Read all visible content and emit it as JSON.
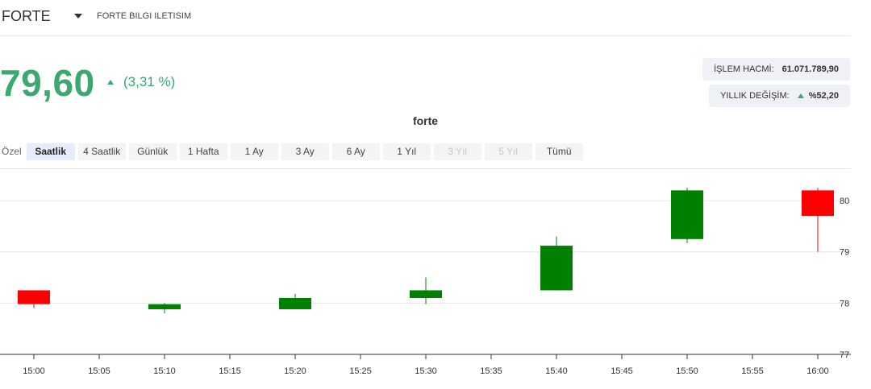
{
  "header": {
    "symbol": "FORTE",
    "company": "FORTE BILGI ILETISIM"
  },
  "quote": {
    "price": "79,60",
    "change": "(3,31 %)",
    "direction": "up",
    "up_color": "#3aa86f"
  },
  "stats": {
    "volume_label": "İŞLEM HACMİ:",
    "volume_value": "61.071.789,90",
    "yearly_label": "YILLIK DEĞİŞİM:",
    "yearly_value": "%52,20"
  },
  "ranges": {
    "label": "Özel",
    "items": [
      {
        "label": "Saatlik",
        "active": true,
        "disabled": false
      },
      {
        "label": "4 Saatlik",
        "active": false,
        "disabled": false
      },
      {
        "label": "Günlük",
        "active": false,
        "disabled": false
      },
      {
        "label": "1 Hafta",
        "active": false,
        "disabled": false
      },
      {
        "label": "1 Ay",
        "active": false,
        "disabled": false
      },
      {
        "label": "3 Ay",
        "active": false,
        "disabled": false
      },
      {
        "label": "6 Ay",
        "active": false,
        "disabled": false
      },
      {
        "label": "1 Yıl",
        "active": false,
        "disabled": false
      },
      {
        "label": "3 Yıl",
        "active": false,
        "disabled": true
      },
      {
        "label": "5 Yıl",
        "active": false,
        "disabled": true
      },
      {
        "label": "Tümü",
        "active": false,
        "disabled": false
      }
    ]
  },
  "chart_data": {
    "type": "candlestick",
    "title": "forte",
    "xlabel": "",
    "ylabel": "",
    "x_ticks": [
      "15:00",
      "15:05",
      "15:10",
      "15:15",
      "15:20",
      "15:25",
      "15:30",
      "15:35",
      "15:40",
      "15:45",
      "15:50",
      "15:55",
      "16:00"
    ],
    "y_ticks": [
      77,
      78,
      79,
      80
    ],
    "ylim": [
      77,
      80.3
    ],
    "grid": true,
    "up_color": "#008000",
    "down_color": "#ff0000",
    "candles": [
      {
        "time": "15:00",
        "open": 78.25,
        "high": 78.25,
        "low": 77.9,
        "close": 77.98
      },
      {
        "time": "15:10",
        "open": 77.88,
        "high": 78.0,
        "low": 77.8,
        "close": 77.98
      },
      {
        "time": "15:20",
        "open": 77.88,
        "high": 78.18,
        "low": 77.88,
        "close": 78.1
      },
      {
        "time": "15:30",
        "open": 78.1,
        "high": 78.5,
        "low": 77.98,
        "close": 78.25
      },
      {
        "time": "15:40",
        "open": 78.25,
        "high": 79.3,
        "low": 78.25,
        "close": 79.12
      },
      {
        "time": "15:50",
        "open": 79.25,
        "high": 80.25,
        "low": 79.17,
        "close": 80.2
      },
      {
        "time": "16:00",
        "open": 80.2,
        "high": 80.25,
        "low": 79.0,
        "close": 79.7
      }
    ]
  }
}
